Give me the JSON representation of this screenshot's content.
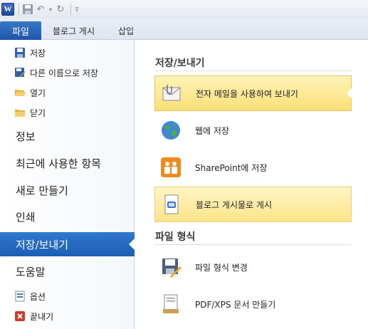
{
  "app": {
    "logo_letter": "W"
  },
  "qat": {
    "icons": [
      "word-logo-icon",
      "save-icon",
      "undo-icon",
      "dropdown-icon",
      "redo-icon",
      "customize-icon"
    ]
  },
  "ribbon": {
    "file_tab": "파일",
    "tabs": [
      "블로그 게시",
      "삽입"
    ]
  },
  "nav": {
    "small_items": [
      {
        "label": "저장",
        "icon": "save-icon"
      },
      {
        "label": "다른 이름으로 저장",
        "icon": "save-as-icon"
      },
      {
        "label": "열기",
        "icon": "open-folder-icon"
      },
      {
        "label": "닫기",
        "icon": "close-folder-icon"
      }
    ],
    "big_items": [
      {
        "label": "정보"
      },
      {
        "label": "최근에 사용한 항목"
      },
      {
        "label": "새로 만들기"
      },
      {
        "label": "인쇄"
      },
      {
        "label": "저장/보내기",
        "active": true
      },
      {
        "label": "도움말"
      }
    ],
    "bottom_items": [
      {
        "label": "옵션",
        "icon": "options-icon"
      },
      {
        "label": "끝내기",
        "icon": "exit-icon"
      }
    ]
  },
  "main": {
    "section1": {
      "title": "저장/보내기",
      "options": [
        {
          "label": "전자 메일을 사용하여 보내기",
          "icon": "email-attachment-icon",
          "state": "selected"
        },
        {
          "label": "웹에 저장",
          "icon": "globe-icon"
        },
        {
          "label": "SharePoint에 저장",
          "icon": "sharepoint-icon"
        },
        {
          "label": "블로그 게시물로 게시",
          "icon": "blog-post-icon",
          "state": "hover"
        }
      ]
    },
    "section2": {
      "title": "파일 형식",
      "options": [
        {
          "label": "파일 형식 변경",
          "icon": "change-file-type-icon"
        },
        {
          "label": "PDF/XPS 문서 만들기",
          "icon": "pdf-xps-icon"
        }
      ]
    }
  },
  "colors": {
    "file_tab": "#1d56a8",
    "active_nav": "#2f78cc",
    "selected_option": "#fcdf78"
  }
}
